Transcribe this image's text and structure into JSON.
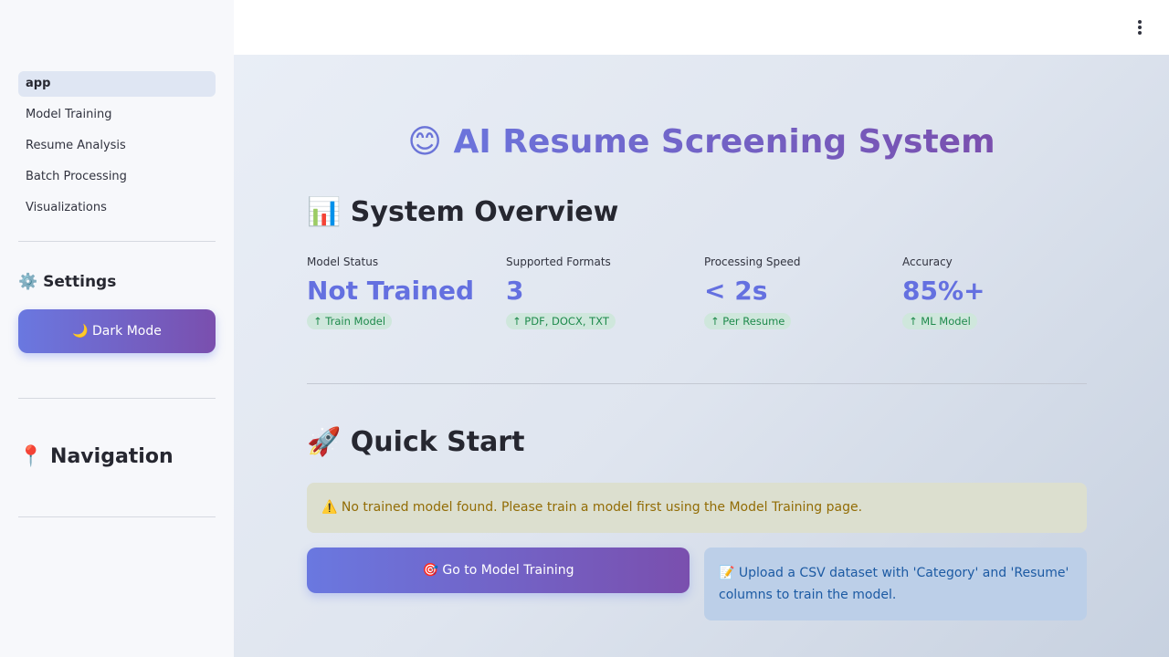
{
  "sidebar": {
    "nav_items": [
      "app",
      "Model Training",
      "Resume Analysis",
      "Batch Processing",
      "Visualizations"
    ],
    "settings_header": "⚙️ Settings",
    "dark_mode_label": "🌙 Dark Mode",
    "navigation_header": "📍 Navigation"
  },
  "main": {
    "title_icon": "😊",
    "title_text": "AI Resume Screening System",
    "overview_header": "📊 System Overview",
    "metrics": [
      {
        "label": "Model Status",
        "value": "Not Trained",
        "delta": "↑ Train Model"
      },
      {
        "label": "Supported Formats",
        "value": "3",
        "delta": "↑ PDF, DOCX, TXT"
      },
      {
        "label": "Processing Speed",
        "value": "< 2s",
        "delta": "↑ Per Resume"
      },
      {
        "label": "Accuracy",
        "value": "85%+",
        "delta": "↑ ML Model"
      }
    ],
    "quickstart_header": "🚀 Quick Start",
    "warning": "⚠️ No trained model found. Please train a model first using the Model Training page.",
    "go_button": "🎯 Go to Model Training",
    "info": "📝 Upload a CSV dataset with 'Category' and 'Resume' columns to train the model."
  },
  "colors": {
    "accent": "#667eea",
    "accent_end": "#764ba2",
    "metric_value": "#6470e0",
    "delta_bg": "#cfe7dc",
    "delta_text": "#1e8a4c",
    "warning_bg": "#dcdfcf",
    "warning_text": "#926c05",
    "info_bg": "#bccfe8",
    "info_text": "#1c5aa3"
  },
  "icons": {
    "menu": "kebab-menu-icon"
  }
}
